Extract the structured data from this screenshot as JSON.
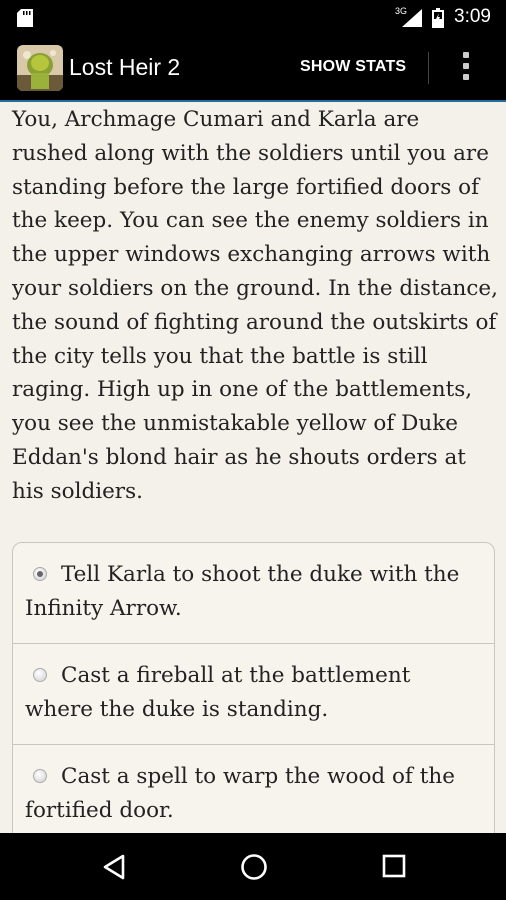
{
  "status_bar": {
    "network_label": "3G",
    "time": "3:09"
  },
  "app_bar": {
    "title": "Lost Heir 2",
    "show_stats_label": "SHOW STATS"
  },
  "story": {
    "text": "You, Archmage Cumari and Karla are rushed along with the soldiers until you are standing before the large fortified doors of the keep. You can see the enemy soldiers in the upper windows exchanging arrows with your soldiers on the ground. In the distance, the sound of fighting around the outskirts of the city tells you that the battle is still raging. High up in one of the battlements, you see the unmistakable yellow of Duke Eddan's blond hair as he shouts orders at his soldiers."
  },
  "choices": [
    {
      "label": "Tell Karla to shoot the duke with the Infinity Arrow.",
      "selected": true
    },
    {
      "label": "Cast a fireball at the battlement where the duke is standing.",
      "selected": false
    },
    {
      "label": "Cast a spell to warp the wood of the fortified door.",
      "selected": false
    }
  ]
}
